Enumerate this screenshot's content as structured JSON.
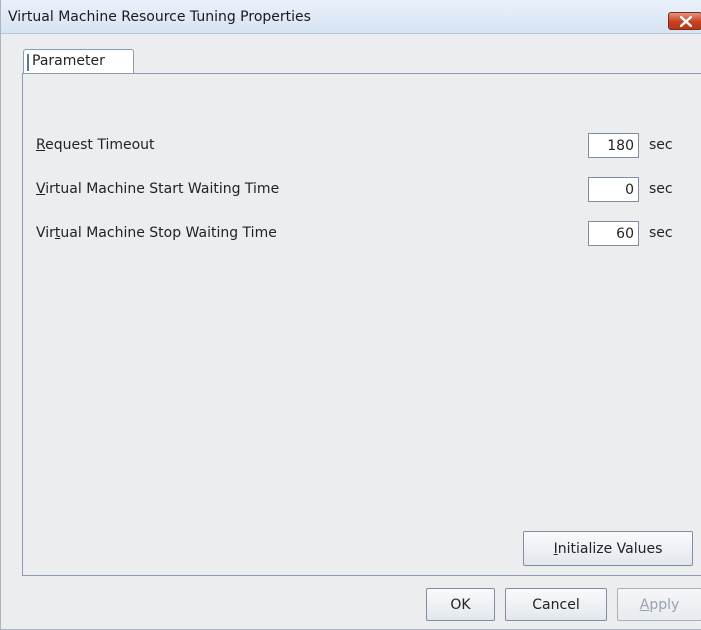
{
  "window": {
    "title": "Virtual Machine Resource Tuning Properties",
    "close_icon": "close-icon",
    "accent_color": "#c7401f"
  },
  "tabs": [
    {
      "label": "Parameter",
      "selected": true
    }
  ],
  "parameters": [
    {
      "label_pre": "",
      "label_mnemonic": "R",
      "label_post": "equest Timeout",
      "value": "180",
      "unit": "sec"
    },
    {
      "label_pre": "",
      "label_mnemonic": "V",
      "label_post": "irtual Machine Start Waiting Time",
      "value": "0",
      "unit": "sec"
    },
    {
      "label_pre": "Vir",
      "label_mnemonic": "t",
      "label_post": "ual Machine Stop Waiting Time",
      "value": "60",
      "unit": "sec"
    }
  ],
  "buttons": {
    "initialize": {
      "mnemonic": "I",
      "rest": "nitialize Values"
    },
    "ok": "OK",
    "cancel": "Cancel",
    "apply": {
      "mnemonic": "A",
      "rest": "pply",
      "enabled": false
    }
  }
}
